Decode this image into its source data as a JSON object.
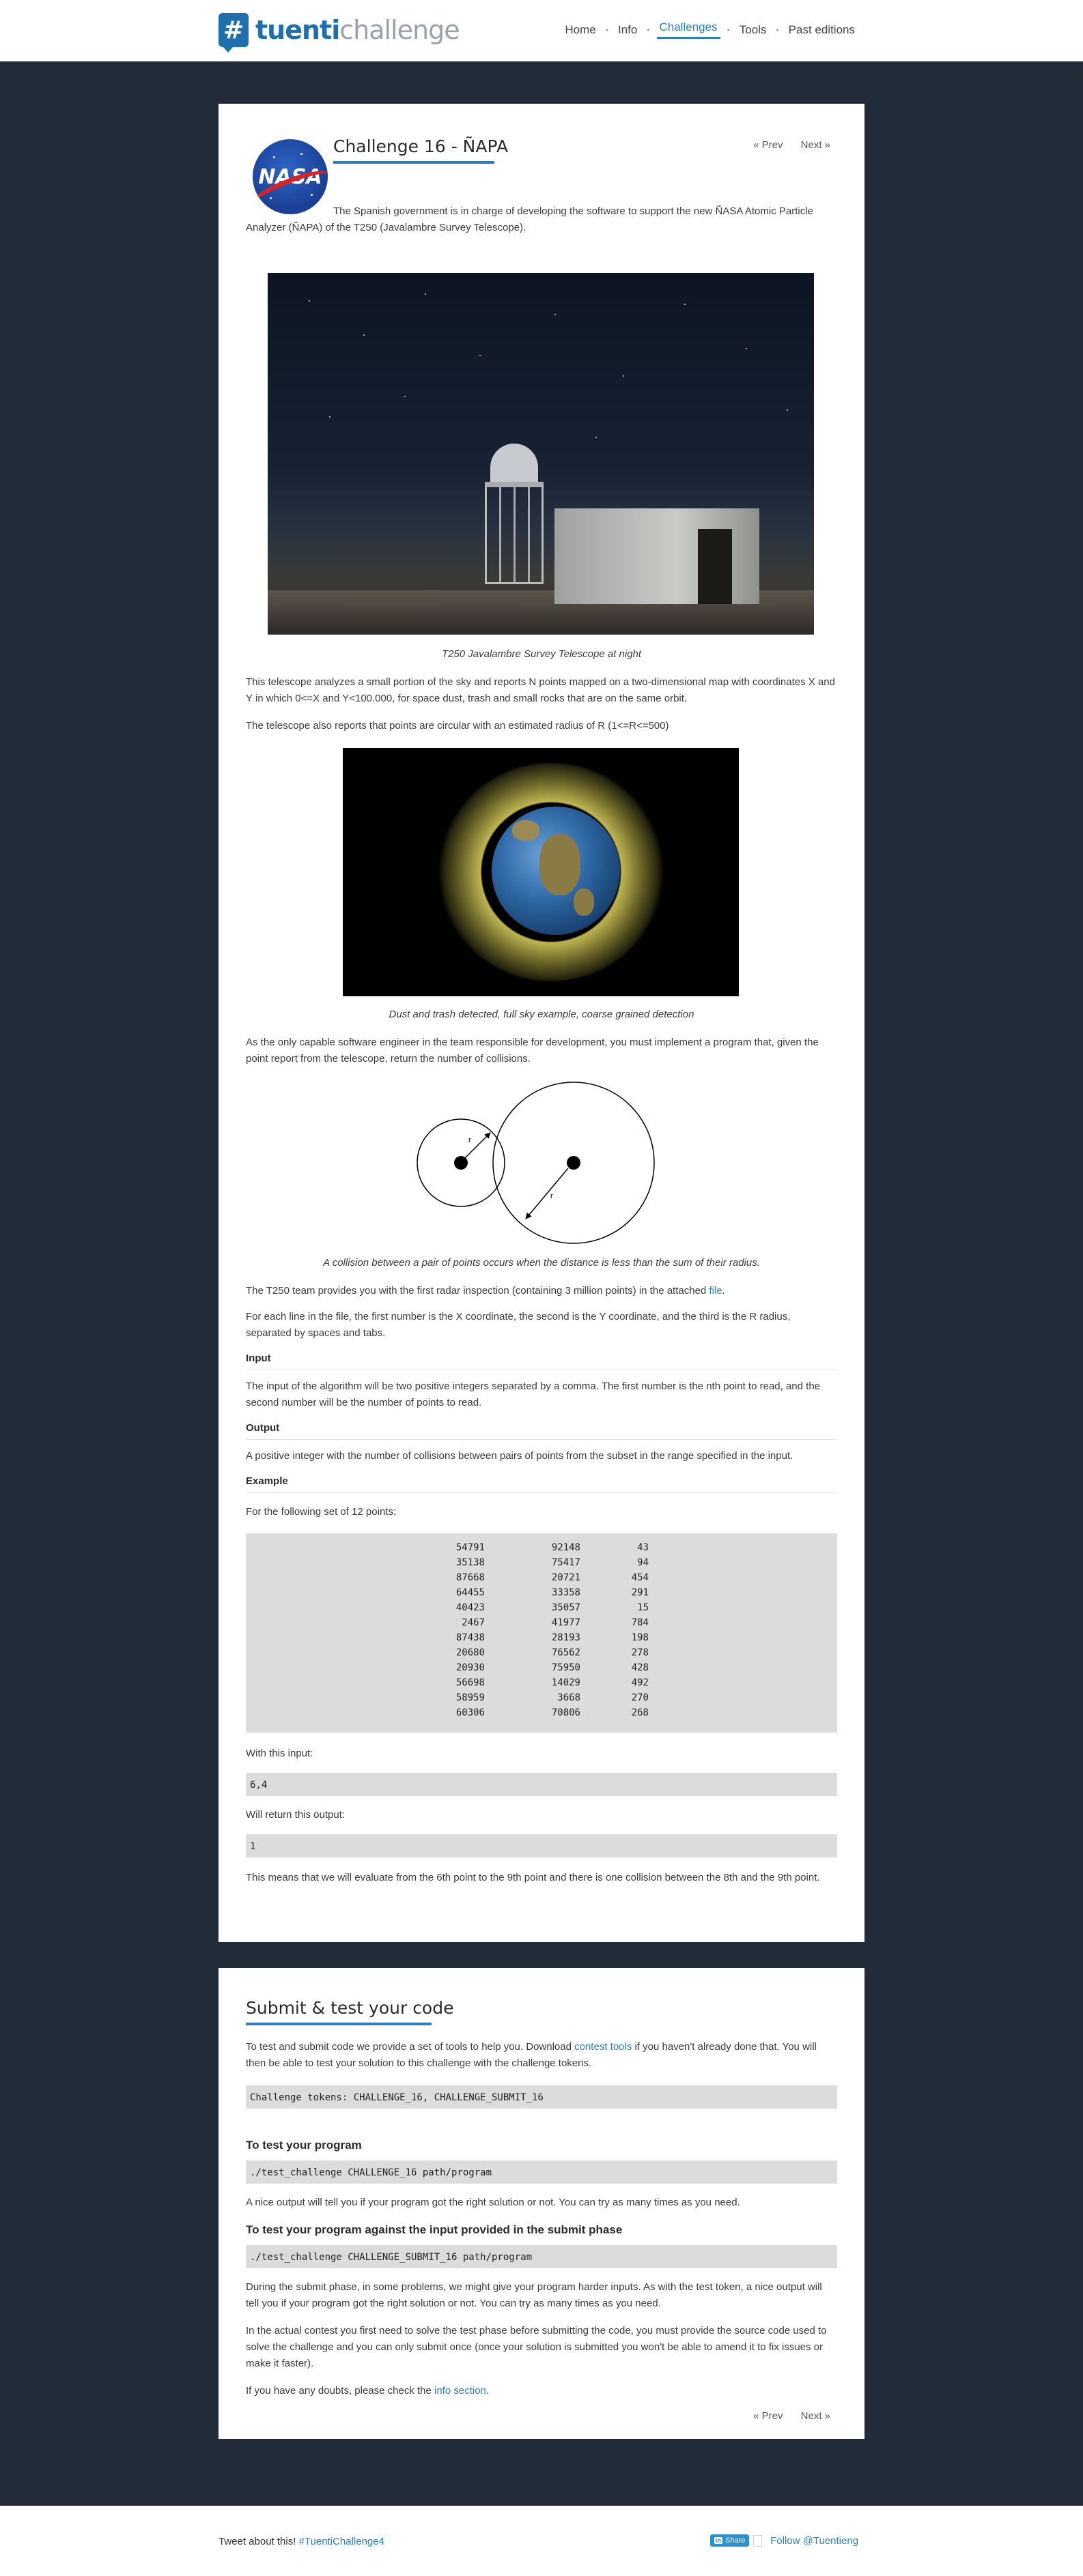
{
  "header": {
    "logo_badge": "#",
    "logo_bold": "tuenti",
    "logo_light": "challenge",
    "nav": [
      "Home",
      "Info",
      "Challenges",
      "Tools",
      "Past editions"
    ],
    "nav_active": "Challenges"
  },
  "challenge": {
    "title": "Challenge 16 - ÑAPA",
    "prev": "« Prev",
    "next": "Next »",
    "logo_text": "NASA",
    "intro": "The Spanish government is in charge of developing the software to support the new ÑASA Atomic Particle Analyzer (ÑAPA) of the T250 (Javalambre Survey Telescope).",
    "caption_photo": "T250 Javalambre Survey Telescope at night",
    "p1": "This telescope analyzes a small portion of the sky and reports N points mapped on a two-dimensional map with coordinates X and Y in which 0<=X and Y<100.000, for space dust, trash and small rocks that are on the same orbit.",
    "p2": "The telescope also reports that points are circular with an estimated radius of R (1<=R<=500)",
    "caption_earth": "Dust and trash detected, full sky example, coarse grained detection",
    "p3": "As the only capable software engineer in the team responsible for development, you must implement a program that, given the point report from the telescope, return the number of collisions.",
    "diagram_label_r": "r",
    "caption_diagram": "A collision between a pair of points occurs when the distance is less than the sum of their radius.",
    "p4_before": "The T250 team provides you with the first radar inspection (containing 3 million points) in the attached ",
    "p4_link": "file",
    "p4_after": ".",
    "p5": "For each line in the file, the first number is the X coordinate, the second is the Y coordinate, and the third is the R radius, separated by spaces and tabs.",
    "input_heading": "Input",
    "input_text": "The input of the algorithm will be two positive integers separated by a comma. The first number is the nth point to read, and the second number will be the number of points to read.",
    "output_heading": "Output",
    "output_text": "A positive integer with the number of collisions between pairs of points from the subset in the range specified in the input.",
    "example_heading": "Example",
    "example_intro": "For the following set of 12 points:",
    "points": [
      [
        "54791",
        "92148",
        "43"
      ],
      [
        "35138",
        "75417",
        "94"
      ],
      [
        "87668",
        "20721",
        "454"
      ],
      [
        "64455",
        "33358",
        "291"
      ],
      [
        "40423",
        "35057",
        "15"
      ],
      [
        "2467",
        "41977",
        "784"
      ],
      [
        "87438",
        "28193",
        "198"
      ],
      [
        "20680",
        "76562",
        "278"
      ],
      [
        "20930",
        "75950",
        "428"
      ],
      [
        "56698",
        "14029",
        "492"
      ],
      [
        "58959",
        "3668",
        "270"
      ],
      [
        "60306",
        "70806",
        "268"
      ]
    ],
    "with_input_label": "With this input:",
    "example_input": "6,4",
    "will_return_label": "Will return this output:",
    "example_output": "1",
    "explanation": "This means that we will evaluate from the 6th point to the 9th point and there is one collision between the 8th and the 9th point."
  },
  "submit": {
    "title": "Submit & test your code",
    "intro_before": "To test and submit code we provide a set of tools to help you. Download ",
    "intro_link": "contest tools",
    "intro_after": " if you haven't already done that. You will then be able to test your solution to this challenge with the challenge tokens.",
    "tokens": "Challenge tokens: CHALLENGE_16, CHALLENGE_SUBMIT_16",
    "test_heading": "To test your program",
    "test_cmd": "./test_challenge CHALLENGE_16 path/program",
    "test_text": "A nice output will tell you if your program got the right solution or not. You can try as many times as you need.",
    "submit_heading": "To test your program against the input provided in the submit phase",
    "submit_cmd": "./test_challenge CHALLENGE_SUBMIT_16 path/program",
    "submit_text": "During the submit phase, in some problems, we might give your program harder inputs. As with the test token, a nice output will tell you if your program got the right solution or not. You can try as many times as you need.",
    "contest_text": "In the actual contest you first need to solve the test phase before submitting the code, you must provide the source code used to solve the challenge and you can only submit once (once your solution is submitted you won't be able to amend it to fix issues or make it faster).",
    "doubts_before": "If you have any doubts, please check the ",
    "doubts_link": "info section",
    "doubts_after": ".",
    "prev": "« Prev",
    "next": "Next »"
  },
  "footer": {
    "tweet_label": "Tweet about this! ",
    "hashtag": "#TuentiChallenge4",
    "share_label": "Share",
    "share_in": "in",
    "follow": "Follow @Tuentieng"
  },
  "colors": {
    "background": "#222b38",
    "accent": "#2b7fc1",
    "code_bg": "#dcdcdc"
  }
}
